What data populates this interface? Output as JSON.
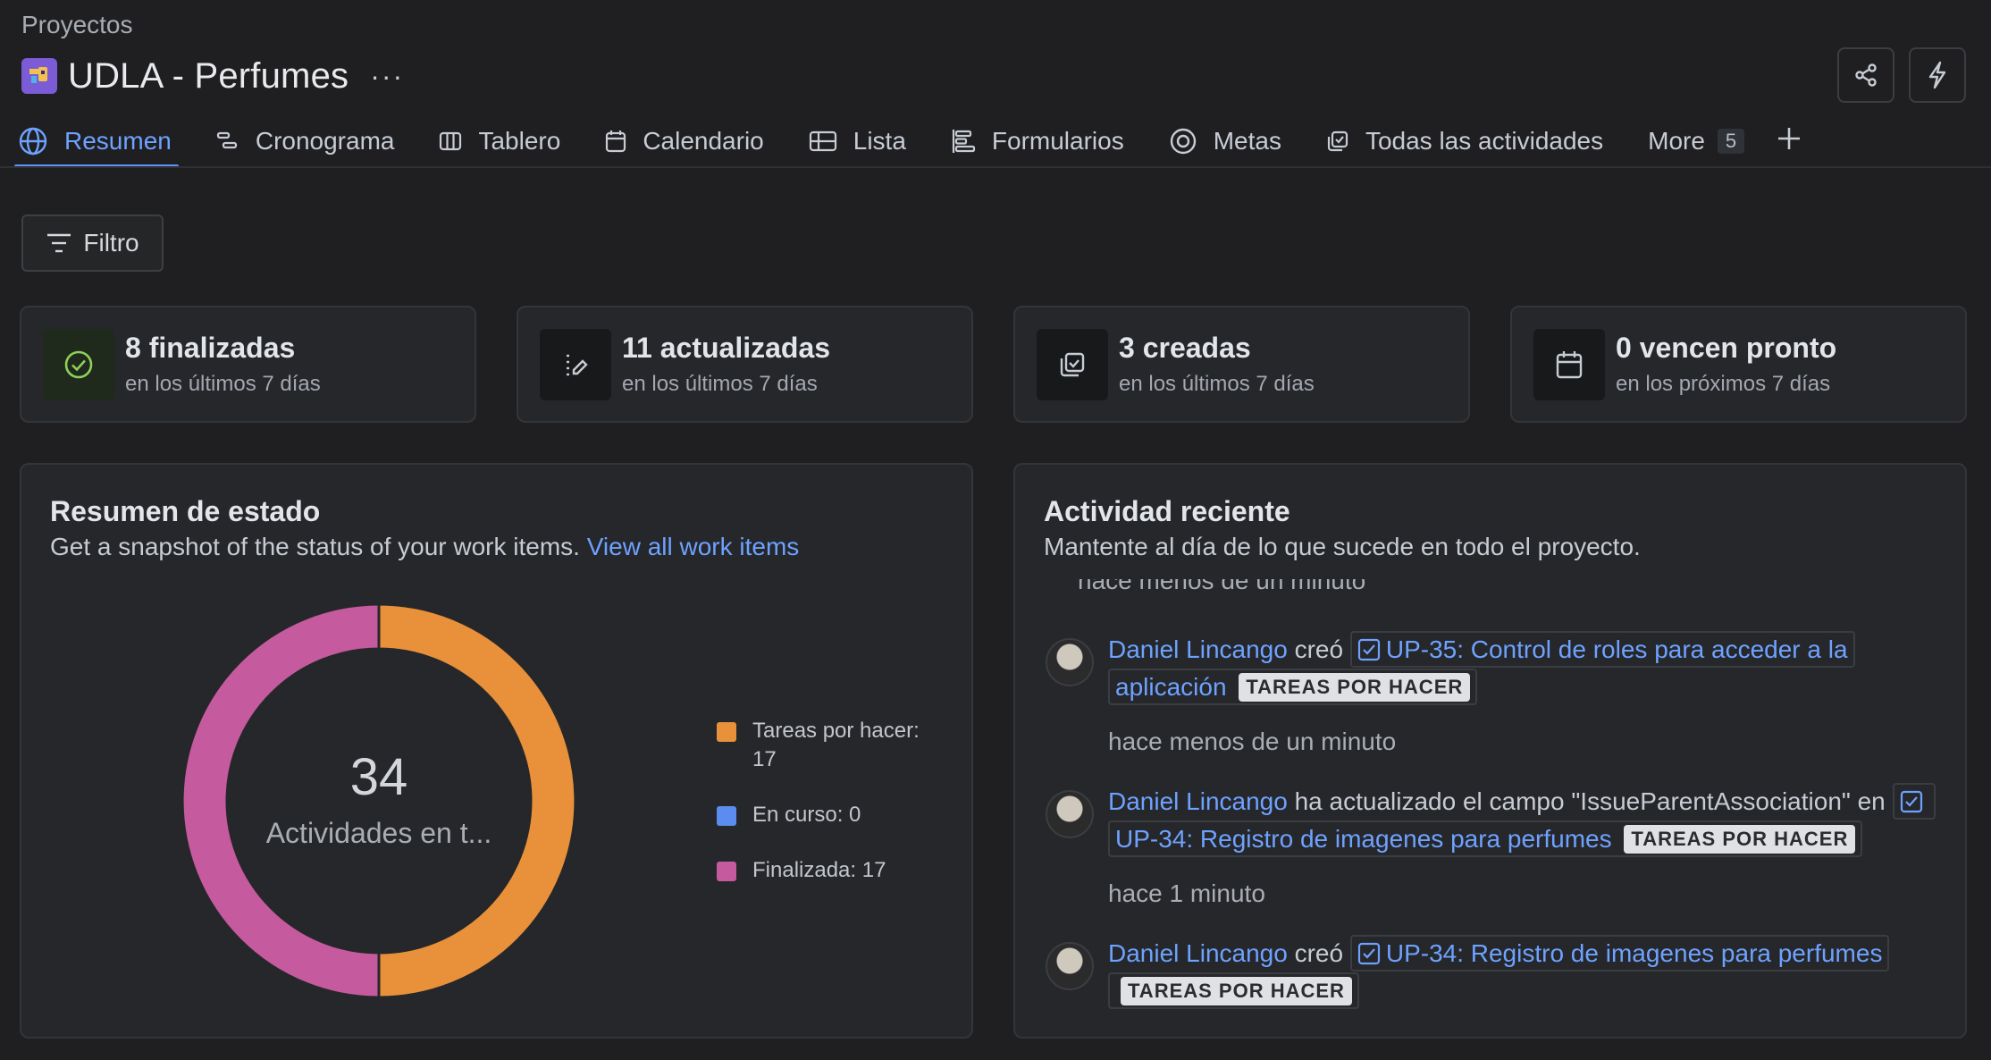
{
  "breadcrumb": "Proyectos",
  "project": {
    "title": "UDLA - Perfumes",
    "more": "···"
  },
  "tabs": [
    {
      "label": "Resumen",
      "icon": "globe-icon",
      "active": true
    },
    {
      "label": "Cronograma",
      "icon": "timeline-icon"
    },
    {
      "label": "Tablero",
      "icon": "board-icon"
    },
    {
      "label": "Calendario",
      "icon": "calendar-icon"
    },
    {
      "label": "Lista",
      "icon": "list-icon"
    },
    {
      "label": "Formularios",
      "icon": "forms-icon"
    },
    {
      "label": "Metas",
      "icon": "target-icon"
    },
    {
      "label": "Todas las actividades",
      "icon": "activities-icon"
    },
    {
      "label": "More",
      "count": "5"
    }
  ],
  "filter": {
    "label": "Filtro"
  },
  "stats": [
    {
      "title": "8 finalizadas",
      "sub": "en los últimos 7 días",
      "icon": "check-circle-icon"
    },
    {
      "title": "11 actualizadas",
      "sub": "en los últimos 7 días",
      "icon": "edit-list-icon"
    },
    {
      "title": "3 creadas",
      "sub": "en los últimos 7 días",
      "icon": "created-icon"
    },
    {
      "title": "0 vencen pronto",
      "sub": "en los próximos 7 días",
      "icon": "calendar-icon"
    }
  ],
  "status_panel": {
    "title": "Resumen de estado",
    "desc": "Get a snapshot of the status of your work items.",
    "link": "View all work items",
    "total": "34",
    "total_label": "Actividades en t...",
    "legend": [
      {
        "label": "Tareas por hacer: 17",
        "color": "#e8913a"
      },
      {
        "label": "En curso: 0",
        "color": "#5b8def"
      },
      {
        "label": "Finalizada: 17",
        "color": "#c55a9e"
      }
    ]
  },
  "chart_data": {
    "type": "pie",
    "categories": [
      "Tareas por hacer",
      "En curso",
      "Finalizada"
    ],
    "values": [
      17,
      0,
      17
    ],
    "colors": [
      "#e8913a",
      "#5b8def",
      "#c55a9e"
    ]
  },
  "activity_panel": {
    "title": "Actividad reciente",
    "desc": "Mantente al día de lo que sucede en todo el proyecto.",
    "partial_time": "hace menos de un minuto",
    "items": [
      {
        "user": "Daniel Lincango",
        "action": "creó",
        "issue": "UP-35: Control de roles para acceder a la aplicación",
        "status": "TAREAS POR HACER",
        "time": "hace menos de un minuto"
      },
      {
        "user": "Daniel Lincango",
        "action": "ha actualizado el campo \"IssueParentAssociation\" en",
        "issue": "UP-34: Registro de imagenes para perfumes",
        "status": "TAREAS POR HACER",
        "time": "hace 1 minuto"
      },
      {
        "user": "Daniel Lincango",
        "action": "creó",
        "issue": "UP-34: Registro de imagenes para perfumes",
        "status": "TAREAS POR HACER",
        "time": ""
      }
    ]
  }
}
